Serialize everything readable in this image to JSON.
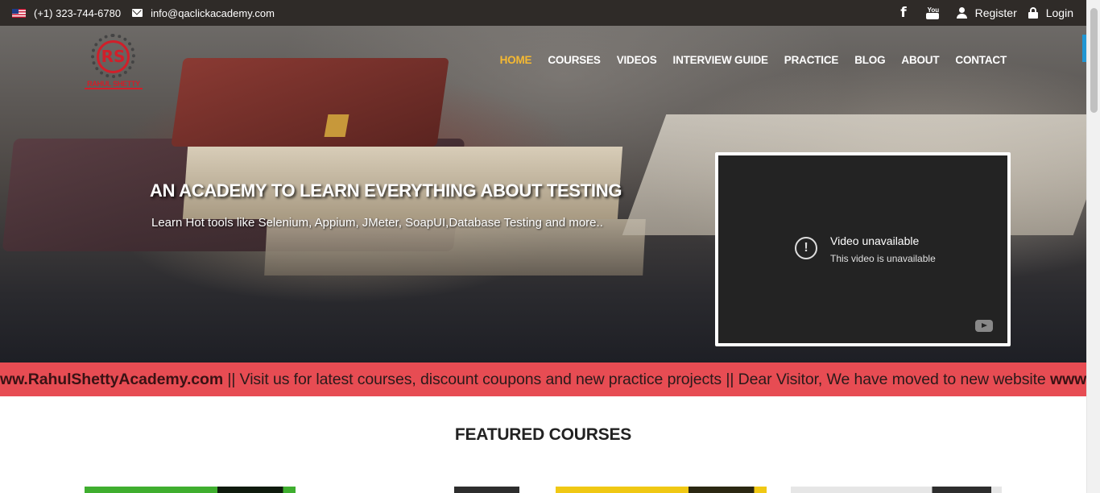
{
  "topbar": {
    "phone": "(+1) 323-744-6780",
    "email": "info@qaclickacademy.com",
    "register": "Register",
    "login": "Login",
    "icons": [
      "us-flag-icon",
      "mail-icon",
      "facebook-icon",
      "youtube-icon",
      "user-icon",
      "lock-icon"
    ]
  },
  "logo": {
    "initials": "RS",
    "text": "RAHUL SHETTY"
  },
  "nav": {
    "items": [
      "HOME",
      "COURSES",
      "VIDEOS",
      "INTERVIEW GUIDE",
      "PRACTICE",
      "BLOG",
      "ABOUT",
      "CONTACT"
    ],
    "active": "HOME"
  },
  "hero": {
    "headline": "AN ACADEMY TO LEARN EVERYTHING ABOUT TESTING",
    "subline": "Learn Hot tools like Selenium, Appium, JMeter, SoapUI,Database Testing and more.."
  },
  "video": {
    "title": "Video unavailable",
    "subtitle": "This video is unavailable"
  },
  "ticker": {
    "site": "ww.RahulShettyAcademy.com",
    "message": " || Visit us for latest courses, discount coupons and new practice projects || Dear Visitor, We have moved to new website ",
    "site_repeat": "www"
  },
  "featured": {
    "title": "FEATURED COURSES"
  },
  "colors": {
    "topbar": "#2f2b28",
    "nav_active": "#f5b932",
    "ticker": "#e74c53",
    "brand_red": "#d01f2a"
  }
}
